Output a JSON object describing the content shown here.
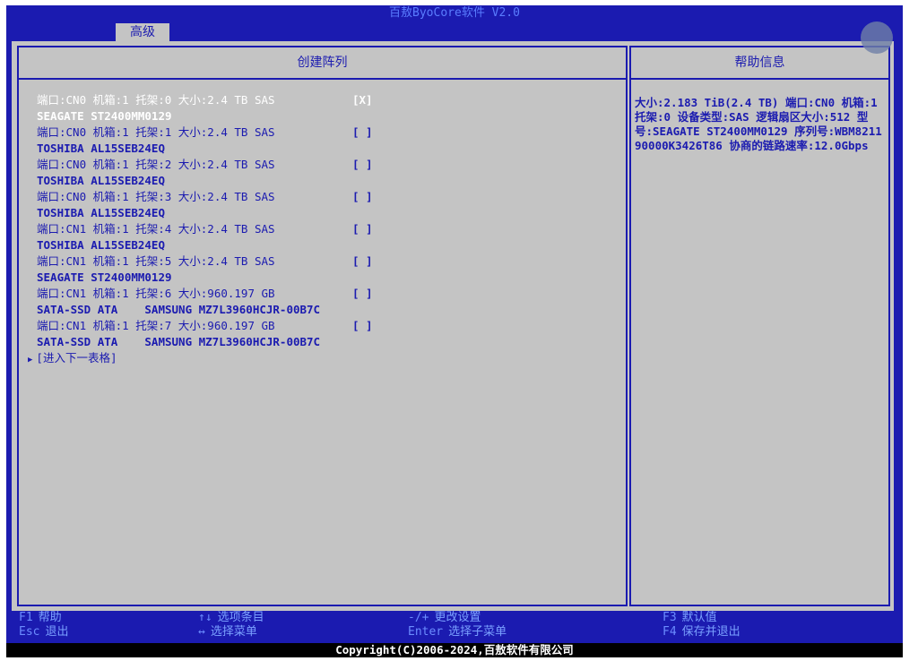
{
  "app": {
    "title": "百敖ByoCore软件 V2.0",
    "active_tab": "高级"
  },
  "left_panel": {
    "title": "创建阵列",
    "disks": [
      {
        "line1": "端口:CN0 机箱:1 托架:0 大小:2.4 TB SAS",
        "line2": "SEAGATE ST2400MM0129",
        "check": "[X]",
        "selected": true
      },
      {
        "line1": "端口:CN0 机箱:1 托架:1 大小:2.4 TB SAS",
        "line2": "TOSHIBA AL15SEB24EQ",
        "check": "[ ]",
        "selected": false
      },
      {
        "line1": "端口:CN0 机箱:1 托架:2 大小:2.4 TB SAS",
        "line2": "TOSHIBA AL15SEB24EQ",
        "check": "[ ]",
        "selected": false
      },
      {
        "line1": "端口:CN0 机箱:1 托架:3 大小:2.4 TB SAS",
        "line2": "TOSHIBA AL15SEB24EQ",
        "check": "[ ]",
        "selected": false
      },
      {
        "line1": "端口:CN1 机箱:1 托架:4 大小:2.4 TB SAS",
        "line2": "TOSHIBA AL15SEB24EQ",
        "check": "[ ]",
        "selected": false
      },
      {
        "line1": "端口:CN1 机箱:1 托架:5 大小:2.4 TB SAS",
        "line2": "SEAGATE ST2400MM0129",
        "check": "[ ]",
        "selected": false
      },
      {
        "line1": "端口:CN1 机箱:1 托架:6 大小:960.197 GB",
        "line2": "SATA-SSD ATA    SAMSUNG MZ7L3960HCJR-00B7C",
        "check": "[ ]",
        "selected": false
      },
      {
        "line1": "端口:CN1 机箱:1 托架:7 大小:960.197 GB",
        "line2": "SATA-SSD ATA    SAMSUNG MZ7L3960HCJR-00B7C",
        "check": "[ ]",
        "selected": false
      }
    ],
    "next_link": "[进入下一表格]"
  },
  "right_panel": {
    "title": "帮助信息",
    "text": "大小:2.183 TiB(2.4 TB) 端口:CN0 机箱:1 托架:0 设备类型:SAS 逻辑扇区大小:512 型号:SEAGATE ST2400MM0129 序列号:WBM821190000K3426T86 协商的链路速率:12.0Gbps"
  },
  "footer": {
    "keys": [
      {
        "key": "F1",
        "desc": "帮助"
      },
      {
        "key": "Esc",
        "desc": "退出"
      },
      {
        "key": "↑↓",
        "desc": "选项条目"
      },
      {
        "key": "↔",
        "desc": "选择菜单"
      },
      {
        "key": "-/+",
        "desc": "更改设置"
      },
      {
        "key": "Enter",
        "desc": "选择子菜单"
      },
      {
        "key": "F3",
        "desc": "默认值"
      },
      {
        "key": "F4",
        "desc": "保存并退出"
      }
    ],
    "copyright": "Copyright(C)2006-2024,百敖软件有限公司"
  }
}
